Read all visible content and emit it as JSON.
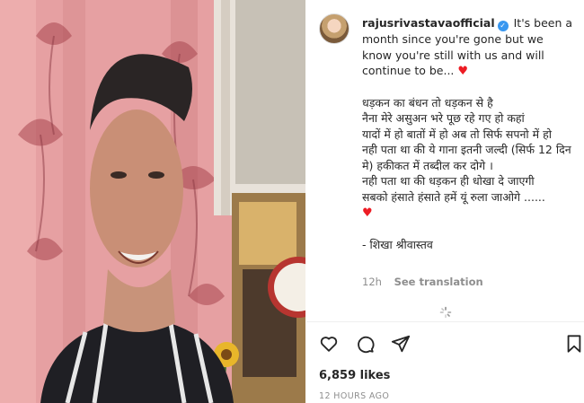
{
  "post": {
    "username": "rajusrivastavaofficial",
    "caption_intro": "It's been a month since you're gone but we know you're still with us and will continue to be...",
    "lyrics": [
      "धड़कन का बंधन तो धड़कन से है",
      "नैना मेरे असुअन भरे पूछ रहे गए हो कहां",
      "यादों में हो बातों में हो अब तो सिर्फ सपनो में हो",
      "नही पता था की ये गाना इतनी जल्दी (सिर्फ 12 दिन मे) हकीकत में तब्दील कर दोगे ।",
      "नही पता था की धड़कन ही धोखा दे जाएगी",
      "सबको हंसाते हंसाते हमें यूं रुला जाओगे ......"
    ],
    "signature": "- शिखा श्रीवास्तव",
    "time_ago_short": "12h",
    "see_translation": "See translation",
    "likes": "6,859 likes",
    "time_ago": "12 HOURS AGO"
  },
  "icons": {
    "verified": "verified-badge-icon",
    "heart": "red-heart-emoji",
    "like": "heart-outline-icon",
    "comment": "comment-bubble-icon",
    "share": "paper-plane-icon",
    "save": "bookmark-icon"
  },
  "colors": {
    "accent": "#3897f0",
    "heart": "#ed1c24",
    "muted": "#8e8e8e",
    "text": "#262626"
  }
}
